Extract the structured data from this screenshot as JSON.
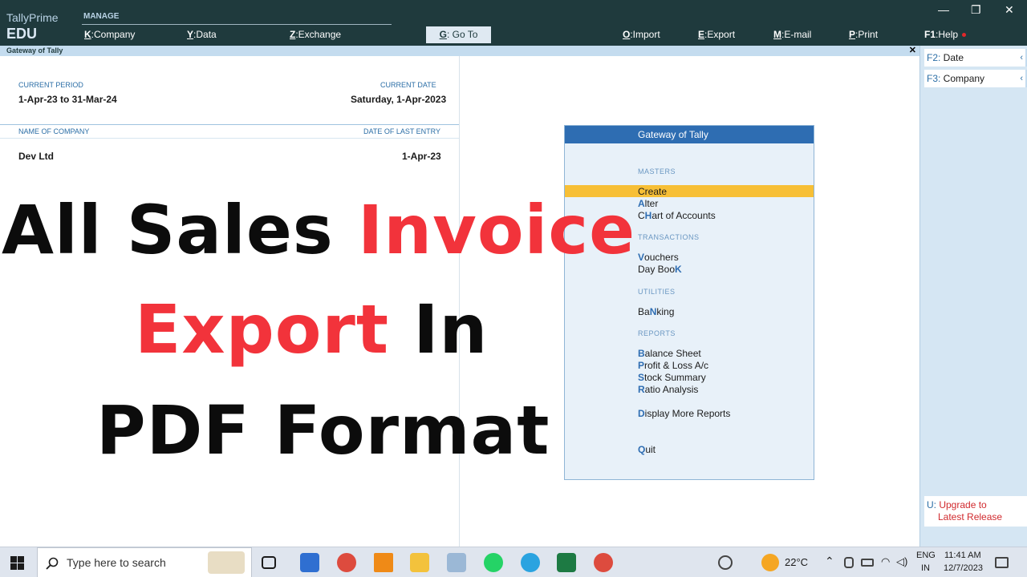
{
  "app": {
    "name": "TallyPrime",
    "edition": "EDU",
    "section_label": "MANAGE"
  },
  "top_menu": {
    "company": {
      "key": "K",
      "label": ":Company"
    },
    "data": {
      "key": "Y",
      "label": ":Data"
    },
    "exchange": {
      "key": "Z",
      "label": ":Exchange"
    },
    "goto": {
      "key": "G",
      "label": ": Go To"
    },
    "import": {
      "key": "O",
      "label": ":Import"
    },
    "export": {
      "key": "E",
      "label": ":Export"
    },
    "email": {
      "key": "M",
      "label": ":E-mail"
    },
    "print": {
      "key": "P",
      "label": ":Print"
    },
    "help": {
      "key": "F1",
      "label": ":Help"
    }
  },
  "window_controls": {
    "minimize": "—",
    "restore": "❐",
    "close": "✕"
  },
  "gateway_bar": {
    "title": "Gateway of Tally",
    "close": "✕"
  },
  "info": {
    "current_period_label": "CURRENT PERIOD",
    "current_period": "1-Apr-23 to 31-Mar-24",
    "current_date_label": "CURRENT DATE",
    "current_date": "Saturday, 1-Apr-2023",
    "company_name_label": "NAME OF COMPANY",
    "last_entry_label": "DATE OF LAST ENTRY",
    "company_name": "Dev Ltd",
    "last_entry": "1-Apr-23"
  },
  "overlay": {
    "line1_a": "All Sales ",
    "line1_b": "Invoice",
    "line2_a": "Export ",
    "line2_b": "In",
    "line3": "PDF Format"
  },
  "gateway_menu": {
    "title": "Gateway of Tally",
    "masters_label": "MASTERS",
    "create": "Create",
    "alter_k": "A",
    "alter_r": "lter",
    "chart_a": "C",
    "chart_k": "H",
    "chart_r": "art of Accounts",
    "transactions_label": "TRANSACTIONS",
    "vouchers_k": "V",
    "vouchers_r": "ouchers",
    "daybook_a": "Day Boo",
    "daybook_k": "K",
    "utilities_label": "UTILITIES",
    "banking_a": "Ba",
    "banking_k": "N",
    "banking_r": "king",
    "reports_label": "REPORTS",
    "balance_k": "B",
    "balance_r": "alance Sheet",
    "pl_k": "P",
    "pl_r": "rofit & Loss A/c",
    "stock_k": "S",
    "stock_r": "tock Summary",
    "ratio_k": "R",
    "ratio_r": "atio Analysis",
    "display_k": "D",
    "display_r": "isplay More Reports",
    "quit_k": "Q",
    "quit_r": "uit"
  },
  "sidebar": {
    "date_key": "F2:",
    "date_label": " Date",
    "company_key": "F3:",
    "company_label": " Company",
    "arrow": "‹",
    "upgrade_key": "U:",
    "upgrade_line1": " Upgrade to",
    "upgrade_line2": "Latest Release"
  },
  "taskbar": {
    "search_placeholder": "Type here to search",
    "weather": "22°C",
    "lang1": "ENG",
    "lang2": "IN",
    "time": "11:41 AM",
    "date": "12/7/2023"
  }
}
